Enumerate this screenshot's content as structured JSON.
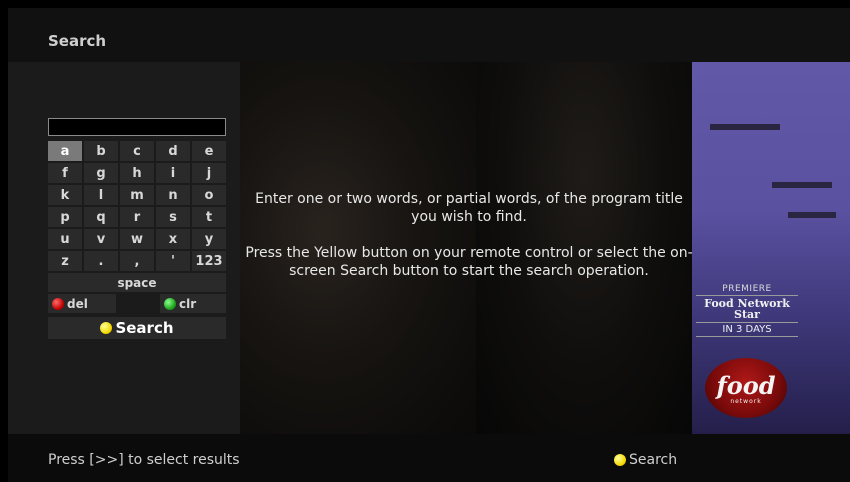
{
  "header": {
    "title": "Search"
  },
  "search": {
    "value": ""
  },
  "keyboard": {
    "rows": [
      [
        "a",
        "b",
        "c",
        "d",
        "e"
      ],
      [
        "f",
        "g",
        "h",
        "i",
        "j"
      ],
      [
        "k",
        "l",
        "m",
        "n",
        "o"
      ],
      [
        "p",
        "q",
        "r",
        "s",
        "t"
      ],
      [
        "u",
        "v",
        "w",
        "x",
        "y"
      ],
      [
        "z",
        ".",
        ",",
        "'",
        "123"
      ]
    ],
    "selected": "a",
    "space_label": "space",
    "del_label": "del",
    "clr_label": "clr",
    "search_label": "Search"
  },
  "instructions": {
    "line1": "Enter one or two words, or partial words, of the program title you wish to find.",
    "line2": "Press the Yellow button on your remote control or select the on-screen Search button to start the search operation."
  },
  "promo": {
    "premiere": "PREMIERE",
    "show": "Food Network Star",
    "when": "IN 3 DAYS",
    "logo_text": "food",
    "logo_sub": "network"
  },
  "footer": {
    "hint": "Press [>>] to select results",
    "search_label": "Search"
  },
  "colors": {
    "red": "#c00000",
    "green": "#1aa01a",
    "yellow": "#f3d800"
  }
}
